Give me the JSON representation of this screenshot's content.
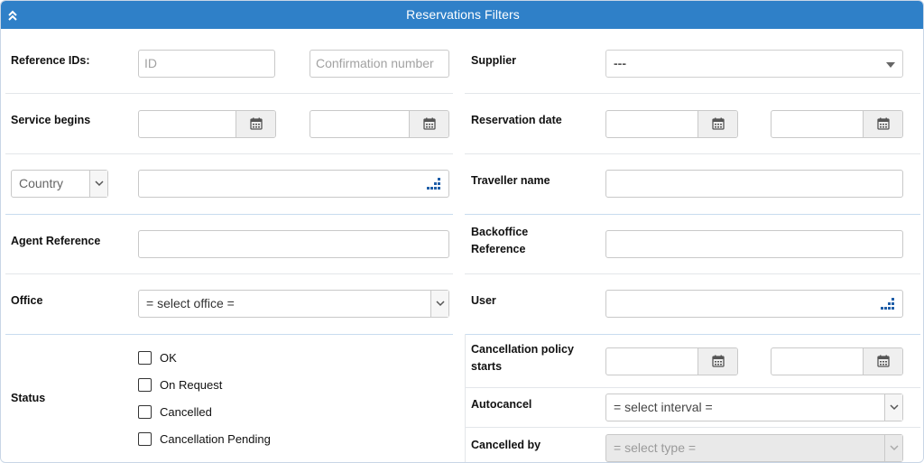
{
  "panel": {
    "title": "Reservations Filters",
    "header_color": "#2f80c8",
    "collapse_icon": "chevrons-up-icon"
  },
  "left": {
    "reference_ids": {
      "label": "Reference IDs:",
      "id_placeholder": "ID",
      "confirmation_placeholder": "Confirmation number"
    },
    "service_begins": {
      "label": "Service begins",
      "from_value": "",
      "to_value": ""
    },
    "country": {
      "selected": "Country",
      "value": ""
    },
    "agent_reference": {
      "label": "Agent Reference",
      "value": ""
    },
    "office": {
      "label": "Office",
      "selected": "= select office ="
    },
    "status": {
      "label": "Status",
      "options": [
        {
          "label": "OK",
          "checked": false
        },
        {
          "label": "On Request",
          "checked": false
        },
        {
          "label": "Cancelled",
          "checked": false
        },
        {
          "label": "Cancellation Pending",
          "checked": false
        }
      ]
    }
  },
  "right": {
    "supplier": {
      "label": "Supplier",
      "selected": "---"
    },
    "reservation_date": {
      "label": "Reservation date",
      "from_value": "",
      "to_value": ""
    },
    "traveller_name": {
      "label": "Traveller name",
      "value": ""
    },
    "backoffice_reference": {
      "label_line1": "Backoffice",
      "label_line2": "Reference",
      "value": ""
    },
    "user": {
      "label": "User",
      "value": ""
    },
    "cancellation_policy_starts": {
      "label_line1": "Cancellation policy",
      "label_line2": "starts",
      "from_value": "",
      "to_value": ""
    },
    "autocancel": {
      "label": "Autocancel",
      "selected": "= select interval ="
    },
    "cancelled_by": {
      "label": "Cancelled by",
      "selected": "= select type ="
    }
  }
}
